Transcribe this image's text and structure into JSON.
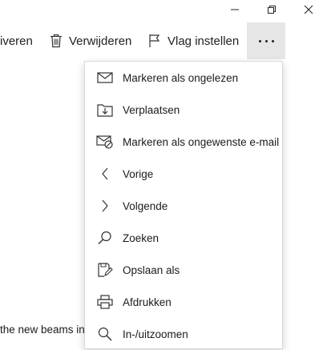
{
  "window": {
    "minimize_icon": "minimize-icon",
    "restore_icon": "restore-icon",
    "close_icon": "close-icon"
  },
  "toolbar": {
    "archive_label": "iveren",
    "delete_label": "Verwijderen",
    "flag_label": "Vlag instellen",
    "more_icon": "more-icon"
  },
  "menu": {
    "items": [
      {
        "label": "Markeren als ongelezen",
        "icon": "envelope-icon"
      },
      {
        "label": "Verplaatsen",
        "icon": "move-icon"
      },
      {
        "label": "Markeren als ongewenste e-mail",
        "icon": "junk-mail-icon"
      },
      {
        "label": "Vorige",
        "icon": "chevron-left-icon"
      },
      {
        "label": "Volgende",
        "icon": "chevron-right-icon"
      },
      {
        "label": "Zoeken",
        "icon": "search-icon"
      },
      {
        "label": "Opslaan als",
        "icon": "save-as-icon"
      },
      {
        "label": "Afdrukken",
        "icon": "printer-icon"
      },
      {
        "label": "In-/uitzoomen",
        "icon": "zoom-icon"
      }
    ]
  },
  "message": {
    "body_snippet": "the new beams in"
  }
}
